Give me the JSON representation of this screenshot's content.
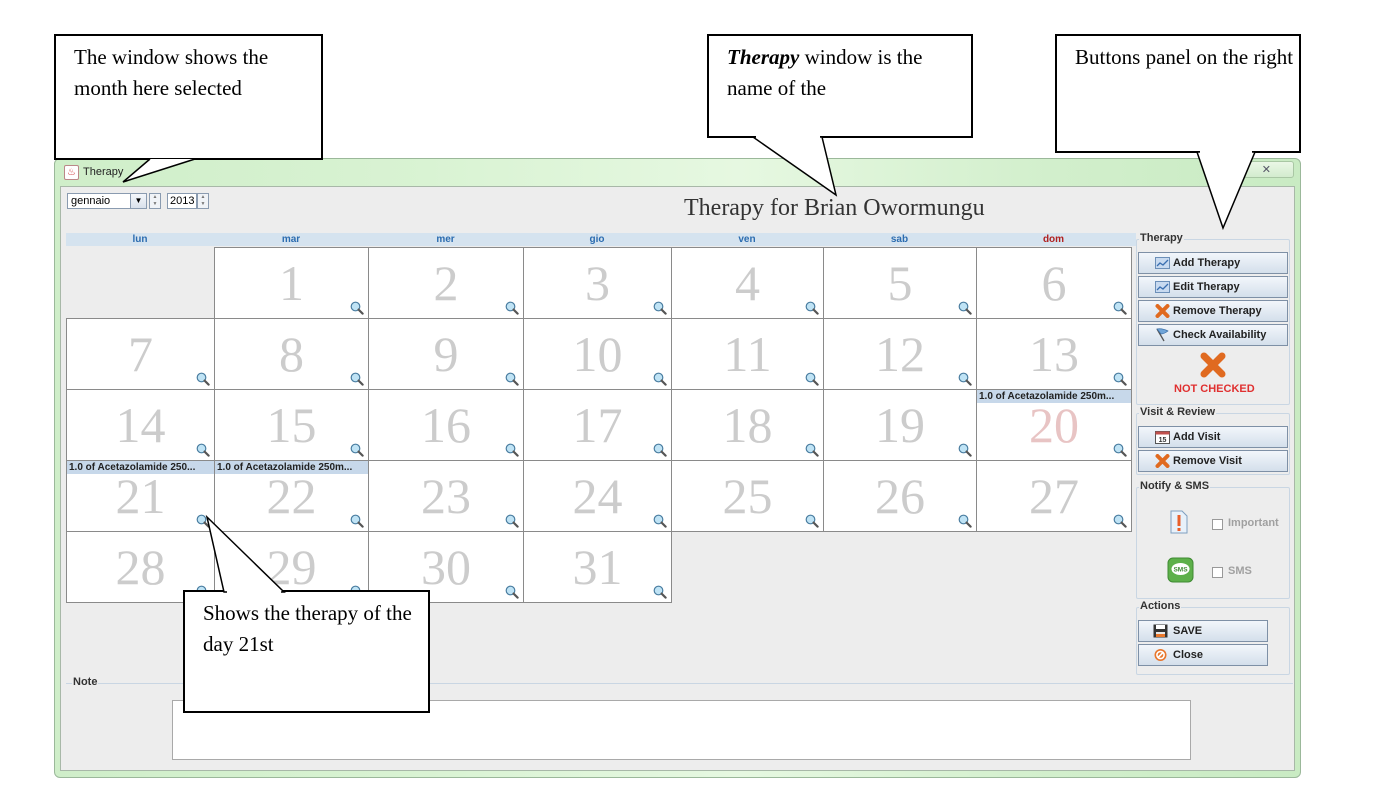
{
  "window": {
    "title": "Therapy",
    "close_label": "✕"
  },
  "controls": {
    "month": "gennaio",
    "year": "2013"
  },
  "heading": "Therapy for Brian Owormungu",
  "calendar": {
    "weekdays": [
      "lun",
      "mar",
      "mer",
      "gio",
      "ven",
      "sab",
      "dom"
    ],
    "weekday_colors": [
      "#2b6cb0",
      "#2b6cb0",
      "#2b6cb0",
      "#2b6cb0",
      "#2b6cb0",
      "#2b6cb0",
      "#b02020"
    ],
    "first_weekday_index": 1,
    "days": [
      "1",
      "2",
      "3",
      "4",
      "5",
      "6",
      "7",
      "8",
      "9",
      "10",
      "11",
      "12",
      "13",
      "14",
      "15",
      "16",
      "17",
      "18",
      "19",
      "20",
      "21",
      "22",
      "23",
      "24",
      "25",
      "26",
      "27",
      "28",
      "29",
      "30",
      "31"
    ],
    "events": {
      "20": "1.0 of Acetazolamide 250m...",
      "21": "1.0 of Acetazolamide 250...",
      "22": "1.0 of Acetazolamide 250m..."
    },
    "highlighted_day": "20"
  },
  "panel": {
    "therapy": {
      "title": "Therapy",
      "add": "Add Therapy",
      "edit": "Edit Therapy",
      "remove": "Remove Therapy",
      "check": "Check Availability",
      "status": "NOT CHECKED"
    },
    "visit": {
      "title": "Visit & Review",
      "add": "Add Visit",
      "remove": "Remove Visit"
    },
    "notify": {
      "title": "Notify & SMS",
      "important": "Important",
      "sms": "SMS",
      "important_checked": false,
      "sms_checked": false
    },
    "actions": {
      "title": "Actions",
      "save": "SAVE",
      "close": "Close"
    }
  },
  "note": {
    "title": "Note",
    "value": ""
  },
  "callouts": {
    "month": "The window shows the month here selected",
    "name_bold": "Therapy",
    "name_rest": " window is the name of the",
    "panel": "Buttons panel on the right",
    "day": "Shows the therapy of the day 21st"
  },
  "colors": {
    "accent_blue": "#2b6cb0",
    "status_red": "#e03030",
    "event_bg": "#c7d8ea"
  }
}
